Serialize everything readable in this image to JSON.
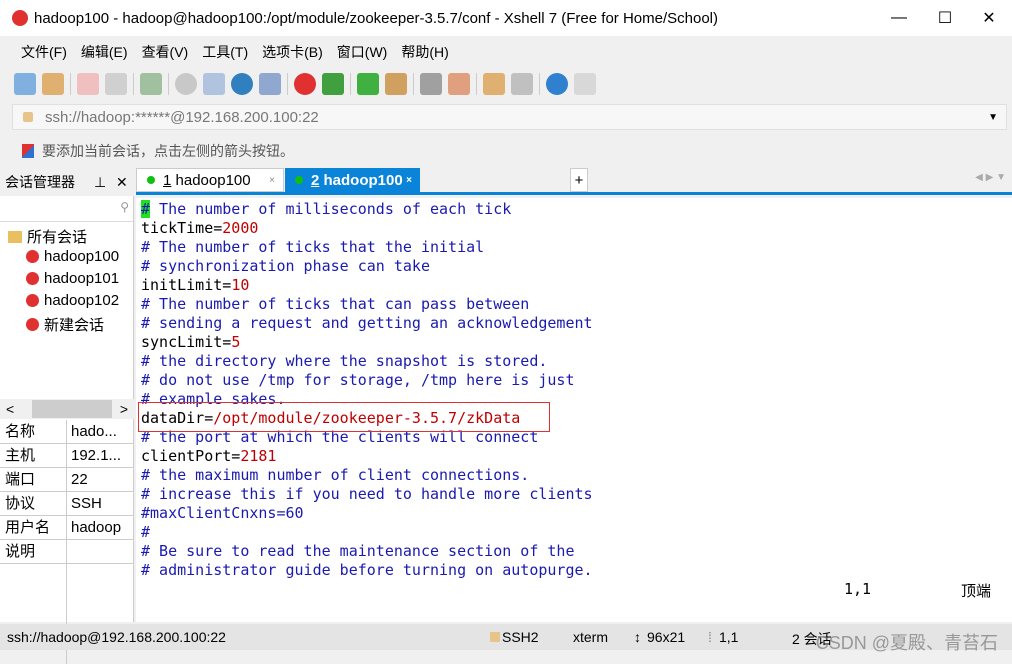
{
  "window": {
    "title": "hadoop100 - hadoop@hadoop100:/opt/module/zookeeper-3.5.7/conf - Xshell 7 (Free for Home/School)",
    "minimize": "—",
    "maximize": "☐",
    "close": "✕"
  },
  "menu": [
    "文件(F)",
    "编辑(E)",
    "查看(V)",
    "工具(T)",
    "选项卡(B)",
    "窗口(W)",
    "帮助(H)"
  ],
  "address": {
    "value": "ssh://hadoop:******@192.168.200.100:22",
    "dropdown": "▼"
  },
  "hint": "要添加当前会话，点击左侧的箭头按钮。",
  "session_manager": {
    "title": "会话管理器",
    "pin": "📌",
    "close": "✕",
    "search_icon": "🔍",
    "tree": {
      "root": "所有会话",
      "items": [
        "hadoop100",
        "hadoop101",
        "hadoop102",
        "新建会话"
      ]
    },
    "props": [
      {
        "k": "名称",
        "v": "hado..."
      },
      {
        "k": "主机",
        "v": "192.1..."
      },
      {
        "k": "端口",
        "v": "22"
      },
      {
        "k": "协议",
        "v": "SSH"
      },
      {
        "k": "用户名",
        "v": "hadoop"
      },
      {
        "k": "说明",
        "v": ""
      }
    ]
  },
  "tabs": [
    {
      "num": "1",
      "label": "hadoop100",
      "close": "×"
    },
    {
      "num": "2",
      "label": "hadoop100",
      "close": "×"
    }
  ],
  "tab_add": "+",
  "tab_nav": "◀ ▶ ▼",
  "terminal": {
    "lines": [
      {
        "c": "# The number of milliseconds of each tick"
      },
      {
        "k": "tickTime=",
        "v": "2000"
      },
      {
        "c": "# The number of ticks that the initial"
      },
      {
        "c": "# synchronization phase can take"
      },
      {
        "k": "initLimit=",
        "v": "10"
      },
      {
        "c": "# The number of ticks that can pass between"
      },
      {
        "c": "# sending a request and getting an acknowledgement"
      },
      {
        "k": "syncLimit=",
        "v": "5"
      },
      {
        "c": "# the directory where the snapshot is stored."
      },
      {
        "c": "# do not use /tmp for storage, /tmp here is just"
      },
      {
        "c": "# example sakes."
      },
      {
        "k": "dataDir=",
        "v": "/opt/module/zookeeper-3.5.7/zkData"
      },
      {
        "c": "# the port at which the clients will connect"
      },
      {
        "k": "clientPort=",
        "v": "2181"
      },
      {
        "c": "# the maximum number of client connections."
      },
      {
        "c": "# increase this if you need to handle more clients"
      },
      {
        "c": "#maxClientCnxns=60"
      },
      {
        "c": "#"
      },
      {
        "c": "# Be sure to read the maintenance section of the"
      },
      {
        "c": "# administrator guide before turning on autopurge."
      }
    ],
    "cursor_pos": "1,1",
    "scroll_pos": "顶端"
  },
  "colors": {
    "comment": "#1a1ab0",
    "value": "#c00000",
    "cursor": "#20e020",
    "accent": "#0a84d8",
    "highlight_box": "#e03030"
  },
  "status": {
    "url": "ssh://hadoop@192.168.200.100:22",
    "protocol": "SSH2",
    "term": "xterm",
    "size": "96x21",
    "pos": "1,1",
    "sessions": "2 会话",
    "watermark": "CSDN @夏殿、青苔石"
  }
}
